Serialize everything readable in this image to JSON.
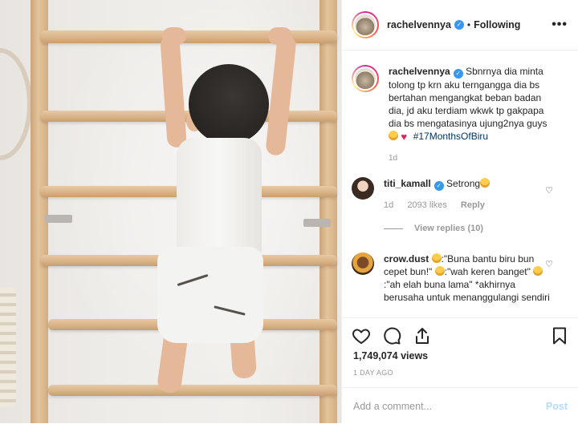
{
  "header": {
    "username": "rachelvennya",
    "separator": "•",
    "follow_state": "Following",
    "more_glyph": "•••"
  },
  "caption": {
    "username": "rachelvennya",
    "text": "Sbnrnya dia minta tolong tp krn aku terngangga dia bs bertahan mengangkat beban badan dia, jd aku terdiam wkwk tp gakpapa dia bs mengatasinya ujung2nya guys",
    "hashtag": "#17MonthsOfBiru",
    "emojis": [
      "laughing-face",
      "red-heart"
    ],
    "age": "1d"
  },
  "comments": [
    {
      "username": "titi_kamall",
      "verified": true,
      "text": "Setrong",
      "emoji": "rolling-laughing-face",
      "age": "1d",
      "likes": "2093 likes",
      "reply_label": "Reply",
      "view_replies": "View replies (10)"
    },
    {
      "username": "crow.dust",
      "verified": false,
      "text_parts": [
        ":\"Buna bantu biru bun cepet bun!\" ",
        ":\"wah keren banget\" ",
        ":\"ah elah buna lama\" *akhirnya berusaha untuk menanggulangi sendiri"
      ],
      "emojis": [
        "baby-face",
        "woman-face",
        "baby-face"
      ]
    }
  ],
  "actions": {
    "views": "1,749,074 views",
    "date": "1 DAY AGO",
    "comment_placeholder": "Add a comment...",
    "post_label": "Post"
  },
  "colors": {
    "link_blue": "#003569",
    "verified_blue": "#3897f0",
    "post_disabled": "#b3dbff",
    "heart_red": "#e0245e"
  }
}
